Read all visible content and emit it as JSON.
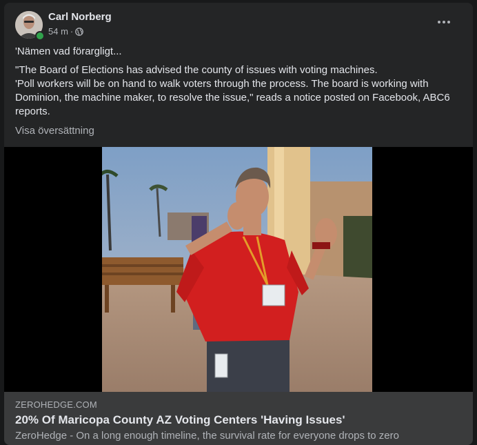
{
  "post": {
    "author": "Carl Norberg",
    "time": "54 m",
    "separator": "·",
    "privacy_icon": "globe-icon",
    "more_icon": "more-dots-icon",
    "lines": [
      "'Nämen vad förargligt...",
      "\"The Board of Elections has advised the county of issues with voting machines.",
      "'Poll workers will be on hand to walk voters through the process. The board is working with Dominion, the machine maker, to resolve the issue,\" reads a notice posted on Facebook, ABC6 reports."
    ],
    "translate_label": "Visa översättning"
  },
  "link": {
    "domain": "ZEROHEDGE.COM",
    "title": "20% Of Maricopa County AZ Voting Centers 'Having Issues'",
    "description": "ZeroHedge - On a long enough timeline, the survival rate for everyone drops to zero"
  },
  "colors": {
    "card": "#242526",
    "link_box": "#3a3b3c",
    "online": "#31a24c",
    "shirt": "#d21f1f"
  }
}
